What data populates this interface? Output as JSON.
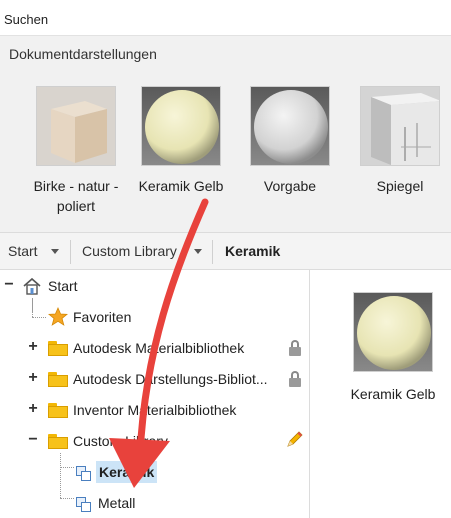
{
  "search": {
    "value": "Suchen"
  },
  "appearances": {
    "title": "Dokumentdarstellungen",
    "items": [
      {
        "label_line1": "Birke - natur -",
        "label_line2": "poliert",
        "icon": "wood-cube-thumbnail"
      },
      {
        "label_line1": "Keramik Gelb",
        "label_line2": "",
        "icon": "yellow-sphere-thumbnail"
      },
      {
        "label_line1": "Vorgabe",
        "label_line2": "",
        "icon": "white-sphere-thumbnail"
      },
      {
        "label_line1": "Spiegel",
        "label_line2": "",
        "icon": "mirror-box-thumbnail"
      }
    ]
  },
  "breadcrumb": {
    "items": [
      "Start",
      "Custom Library",
      "Keramik"
    ]
  },
  "tree": {
    "root": "Start",
    "items": [
      {
        "label": "Favoriten"
      },
      {
        "label": "Autodesk Materialbibliothek",
        "locked": true
      },
      {
        "label": "Autodesk Darstellungs-Bibliot...",
        "locked": true
      },
      {
        "label": "Inventor Materialbibliothek",
        "locked": false
      },
      {
        "label": "Custom Library",
        "editable": true
      },
      {
        "label": "Keramik",
        "selected": true
      },
      {
        "label": "Metall"
      }
    ]
  },
  "preview": {
    "label": "Keramik Gelb",
    "icon": "yellow-sphere-thumbnail"
  },
  "colors": {
    "folder": "#f7c21a",
    "selection": "#cce4f7",
    "arrow": "#e8423c",
    "star": "#f5a623"
  }
}
